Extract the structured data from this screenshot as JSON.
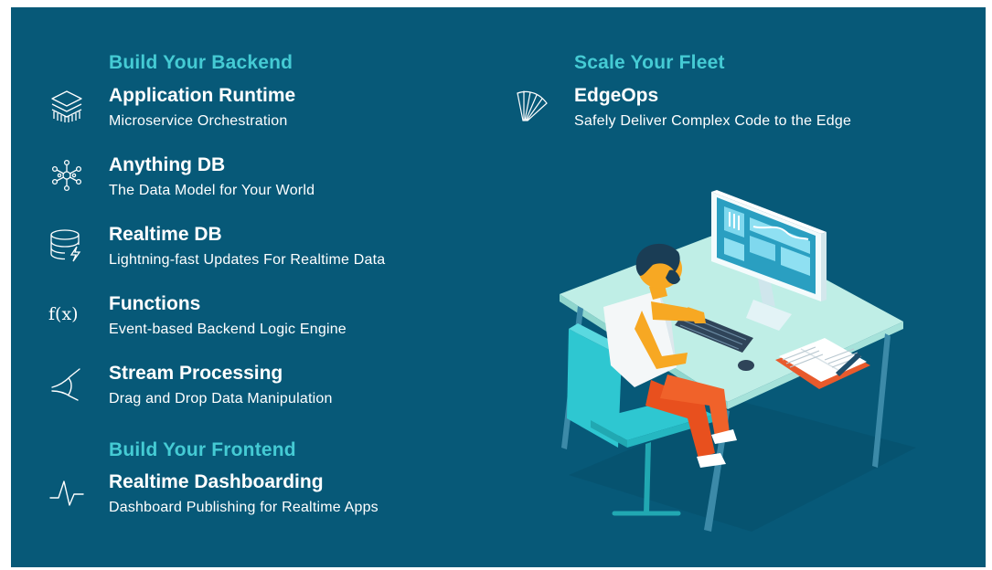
{
  "sections": {
    "backend": {
      "title": "Build Your Backend"
    },
    "frontend": {
      "title": "Build Your Frontend"
    },
    "fleet": {
      "title": "Scale Your Fleet"
    }
  },
  "items": [
    {
      "title": "Application Runtime",
      "subtitle": "Microservice Orchestration",
      "icon": "layers-icon"
    },
    {
      "title": "Anything DB",
      "subtitle": "The Data Model for Your World",
      "icon": "network-nodes-icon"
    },
    {
      "title": "Realtime DB",
      "subtitle": "Lightning-fast Updates For Realtime Data",
      "icon": "database-lightning-icon"
    },
    {
      "title": "Functions",
      "subtitle": "Event-based Backend Logic Engine",
      "icon": "function-icon"
    },
    {
      "title": "Stream Processing",
      "subtitle": "Drag and Drop Data Manipulation",
      "icon": "stream-branch-icon"
    },
    {
      "title": "Realtime Dashboarding",
      "subtitle": "Dashboard Publishing for Realtime Apps",
      "icon": "pulse-line-icon"
    },
    {
      "title": "EdgeOps",
      "subtitle": "Safely Deliver Complex Code to the Edge",
      "icon": "fan-rays-icon"
    }
  ],
  "icons": {
    "function_glyph": "f(x)"
  },
  "colors": {
    "background": "#075978",
    "section_title": "#45cbd4",
    "text": "#ffffff",
    "accent_teal": "#2dcfd6",
    "accent_orange": "#f7a823"
  }
}
